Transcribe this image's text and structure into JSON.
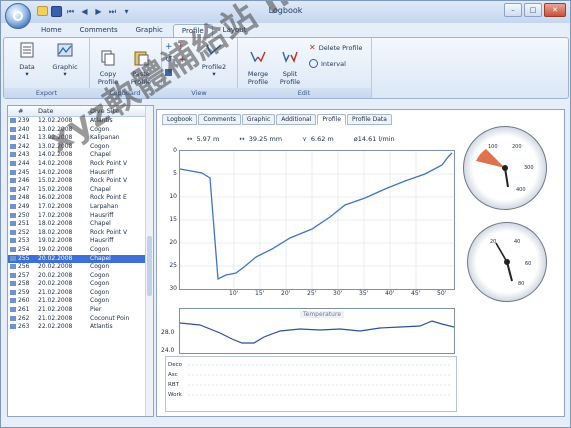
{
  "window": {
    "title": "Logbook"
  },
  "ribbon_tabs": [
    "Home",
    "Comments",
    "Graphic",
    "Profile",
    "Layout"
  ],
  "ribbon": {
    "export": {
      "label": "Export",
      "data": "Data",
      "graphic": "Graphic"
    },
    "clipboard": {
      "label": "Clipboard",
      "copy": "Copy\nProfile",
      "paste": "Paste\nProfile"
    },
    "view": {
      "label": "View",
      "profile2": "Profile2"
    },
    "edit": {
      "label": "Edit",
      "merge": "Merge\nProfile",
      "split": "Split\nProfile",
      "delete": "Delete Profile",
      "interval": "Interval"
    }
  },
  "table": {
    "headers": [
      "#",
      "Date",
      "Dive Site"
    ],
    "rows": [
      [
        "239",
        "12.02.2008",
        "Atlantis"
      ],
      [
        "240",
        "13.02.2008",
        "Cogon"
      ],
      [
        "241",
        "13.02.2008",
        "Kalipanan"
      ],
      [
        "242",
        "13.02.2008",
        "Cogon"
      ],
      [
        "243",
        "14.02.2008",
        "Chapel"
      ],
      [
        "244",
        "14.02.2008",
        "Rock Point V"
      ],
      [
        "245",
        "14.02.2008",
        "Hausriff"
      ],
      [
        "246",
        "15.02.2008",
        "Rock Point V"
      ],
      [
        "247",
        "15.02.2008",
        "Chapel"
      ],
      [
        "248",
        "16.02.2008",
        "Rock Point E"
      ],
      [
        "249",
        "17.02.2008",
        "Larpahan"
      ],
      [
        "250",
        "17.02.2008",
        "Hausriff"
      ],
      [
        "251",
        "18.02.2008",
        "Chapel"
      ],
      [
        "252",
        "18.02.2008",
        "Rock Point V"
      ],
      [
        "253",
        "19.02.2008",
        "Hausriff"
      ],
      [
        "254",
        "19.02.2008",
        "Cogon"
      ],
      [
        "255",
        "20.02.2008",
        "Chapel"
      ],
      [
        "256",
        "20.02.2008",
        "Cogon"
      ],
      [
        "257",
        "20.02.2008",
        "Cogon"
      ],
      [
        "258",
        "20.02.2008",
        "Cogon"
      ],
      [
        "259",
        "21.02.2008",
        "Cogon"
      ],
      [
        "260",
        "21.02.2008",
        "Cogon"
      ],
      [
        "261",
        "21.02.2008",
        "Pier"
      ],
      [
        "262",
        "21.02.2008",
        "Coconut Poin"
      ],
      [
        "263",
        "22.02.2008",
        "Atlantis"
      ]
    ],
    "selected_row": 16
  },
  "panel_tabs": [
    "Logbook",
    "Comments",
    "Graphic",
    "Additional",
    "Profile",
    "Profile Data"
  ],
  "stats": {
    "s1": "5.97 m",
    "s2": "39.25 mm",
    "s3": "6.62 m",
    "s4": "ø14.61 l/min"
  },
  "chart": {
    "y_ticks": [
      "0",
      "5",
      "10",
      "15",
      "20",
      "25",
      "30"
    ],
    "x_ticks": [
      "10'",
      "15'",
      "20'",
      "25'",
      "30'",
      "35'",
      "40'",
      "45'",
      "50'"
    ],
    "temp_label": "Temperature",
    "temp_ticks": [
      "28.0",
      "24.0"
    ],
    "bottom_labels": [
      "Deco",
      "Asc",
      "RBT",
      "Work"
    ]
  },
  "gauge1_ticks": [
    "100",
    "200",
    "300",
    "400"
  ],
  "gauge2_ticks": [
    "20",
    "40",
    "60",
    "80"
  ],
  "watermark": "xyz軟體補給站 http://31.to",
  "colors": {
    "profile": "#3e74c8",
    "selection": "#3d6fd6",
    "accent": "#d95a2c"
  },
  "icons": [
    "data-icon",
    "graphic-icon",
    "copy-icon",
    "paste-icon",
    "profile2-icon",
    "merge-icon",
    "split-icon",
    "delete-icon",
    "interval-icon"
  ]
}
